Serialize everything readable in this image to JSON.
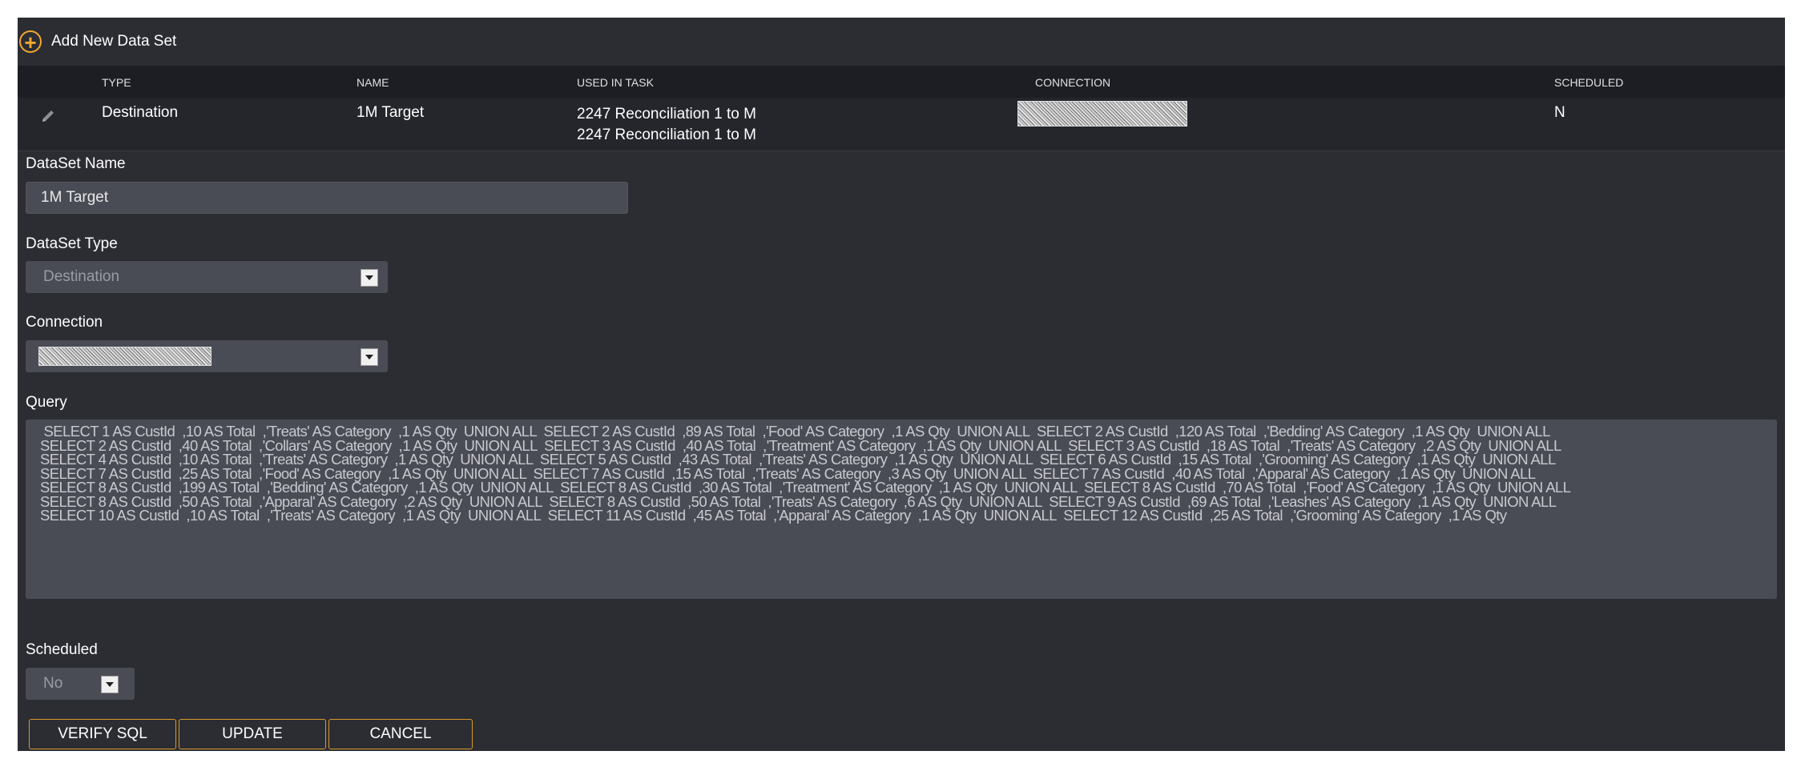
{
  "header": {
    "add_label": "Add New Data Set"
  },
  "table": {
    "columns": [
      "TYPE",
      "NAME",
      "USED IN TASK",
      "CONNECTION",
      "SCHEDULED"
    ],
    "rows": [
      {
        "type": "Destination",
        "name": "1M Target",
        "tasks": [
          "2247 Reconciliation 1 to M",
          "2247 Reconciliation 1 to M"
        ],
        "scheduled": "N"
      }
    ]
  },
  "form": {
    "name_label": "DataSet Name",
    "name_value": "1M Target",
    "type_label": "DataSet Type",
    "type_value": "Destination",
    "connection_label": "Connection",
    "query_label": "Query",
    "query_lines": [
      " SELECT 1 AS CustId  ,10 AS Total  ,'Treats' AS Category  ,1 AS Qty  UNION ALL  SELECT 2 AS CustId  ,89 AS Total  ,'Food' AS Category  ,1 AS Qty  UNION ALL  SELECT 2 AS CustId  ,120 AS Total  ,'Bedding' AS Category  ,1 AS Qty  UNION ALL",
      "SELECT 2 AS CustId  ,40 AS Total  ,'Collars' AS Category  ,1 AS Qty  UNION ALL  SELECT 3 AS CustId  ,40 AS Total  ,'Treatment' AS Category  ,1 AS Qty  UNION ALL  SELECT 3 AS CustId  ,18 AS Total  ,'Treats' AS Category  ,2 AS Qty  UNION ALL",
      "SELECT 4 AS CustId  ,10 AS Total  ,'Treats' AS Category  ,1 AS Qty  UNION ALL  SELECT 5 AS CustId  ,43 AS Total  ,'Treats' AS Category  ,1 AS Qty  UNION ALL  SELECT 6 AS CustId  ,15 AS Total  ,'Grooming' AS Category  ,1 AS Qty  UNION ALL",
      "SELECT 7 AS CustId  ,25 AS Total  ,'Food' AS Category  ,1 AS Qty  UNION ALL  SELECT 7 AS CustId  ,15 AS Total  ,'Treats' AS Category  ,3 AS Qty  UNION ALL  SELECT 7 AS CustId  ,40 AS Total  ,'Apparal' AS Category  ,1 AS Qty  UNION ALL",
      "SELECT 8 AS CustId  ,199 AS Total  ,'Bedding' AS Category  ,1 AS Qty  UNION ALL  SELECT 8 AS CustId  ,30 AS Total  ,'Treatment' AS Category  ,1 AS Qty  UNION ALL  SELECT 8 AS CustId  ,70 AS Total  ,'Food' AS Category  ,1 AS Qty  UNION ALL",
      "SELECT 8 AS CustId  ,50 AS Total  ,'Apparal' AS Category  ,2 AS Qty  UNION ALL  SELECT 8 AS CustId  ,50 AS Total  ,'Treats' AS Category  ,6 AS Qty  UNION ALL  SELECT 9 AS CustId  ,69 AS Total  ,'Leashes' AS Category  ,1 AS Qty  UNION ALL",
      "SELECT 10 AS CustId  ,10 AS Total  ,'Treats' AS Category  ,1 AS Qty  UNION ALL  SELECT 11 AS CustId  ,45 AS Total  ,'Apparal' AS Category  ,1 AS Qty  UNION ALL  SELECT 12 AS CustId  ,25 AS Total  ,'Grooming' AS Category  ,1 AS Qty"
    ],
    "scheduled_label": "Scheduled",
    "scheduled_value": "No"
  },
  "buttons": {
    "verify": "VERIFY SQL",
    "update": "UPDATE",
    "cancel": "CANCEL"
  },
  "colors": {
    "panel_bg": "#2c2d33",
    "header_row_bg": "#1d1e23",
    "input_bg": "#4a4c55",
    "accent": "#f0a830"
  },
  "icons": [
    "plus-circle-icon",
    "pencil-icon",
    "chevron-down-icon"
  ]
}
